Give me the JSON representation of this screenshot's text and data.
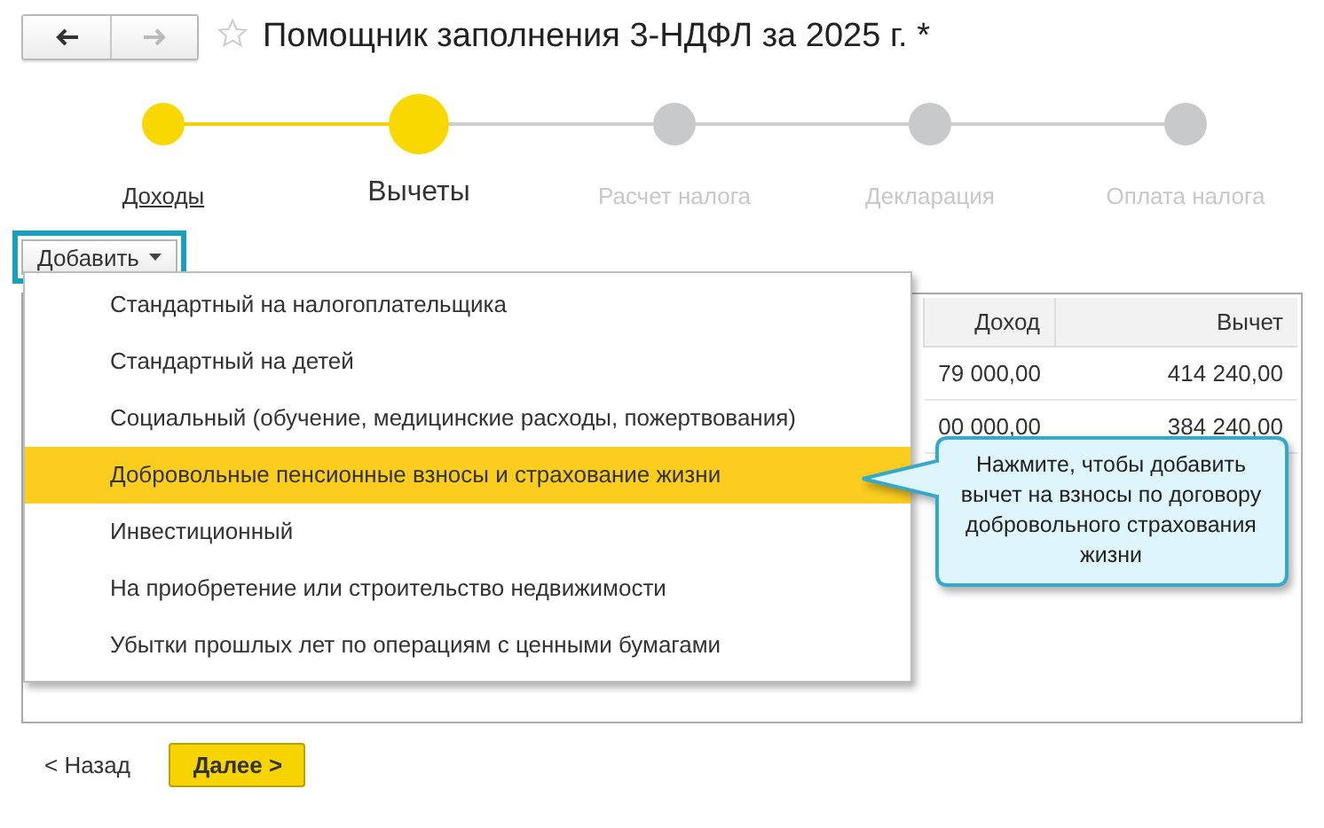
{
  "window": {
    "title": "Помощник заполнения 3-НДФЛ за 2025 г. *",
    "favorite": false
  },
  "steps": [
    {
      "label": "Доходы",
      "completed": true,
      "selected": false
    },
    {
      "label": "Вычеты",
      "completed": false,
      "selected": true
    },
    {
      "label": "Расчет налога",
      "completed": false,
      "selected": false
    },
    {
      "label": "Декларация",
      "completed": false,
      "selected": false
    },
    {
      "label": "Оплата налога",
      "completed": false,
      "selected": false
    }
  ],
  "add_button": {
    "label": "Добавить",
    "highlighted": true
  },
  "table": {
    "columns": [
      "Доход",
      "Вычет"
    ],
    "rows": [
      {
        "income": "79 000,00",
        "deduction": "414 240,00"
      },
      {
        "income": "00 000,00",
        "deduction": "384 240,00"
      }
    ]
  },
  "add_menu": {
    "items": [
      {
        "label": "Стандартный на налогоплательщика",
        "selected": false
      },
      {
        "label": "Стандартный на детей",
        "selected": false
      },
      {
        "label": "Социальный (обучение, медицинские расходы, пожертвования)",
        "selected": false
      },
      {
        "label": "Добровольные пенсионные взносы и страхование жизни",
        "selected": true
      },
      {
        "label": "Инвестиционный",
        "selected": false
      },
      {
        "label": "На приобретение или строительство недвижимости",
        "selected": false
      },
      {
        "label": "Убытки прошлых лет по операциям с ценными бумагами",
        "selected": false
      }
    ]
  },
  "hint": {
    "text": "Нажмите, чтобы добавить вычет на взносы по договору добровольного страхования жизни"
  },
  "footer": {
    "back": "< Назад",
    "next": "Далее >"
  }
}
